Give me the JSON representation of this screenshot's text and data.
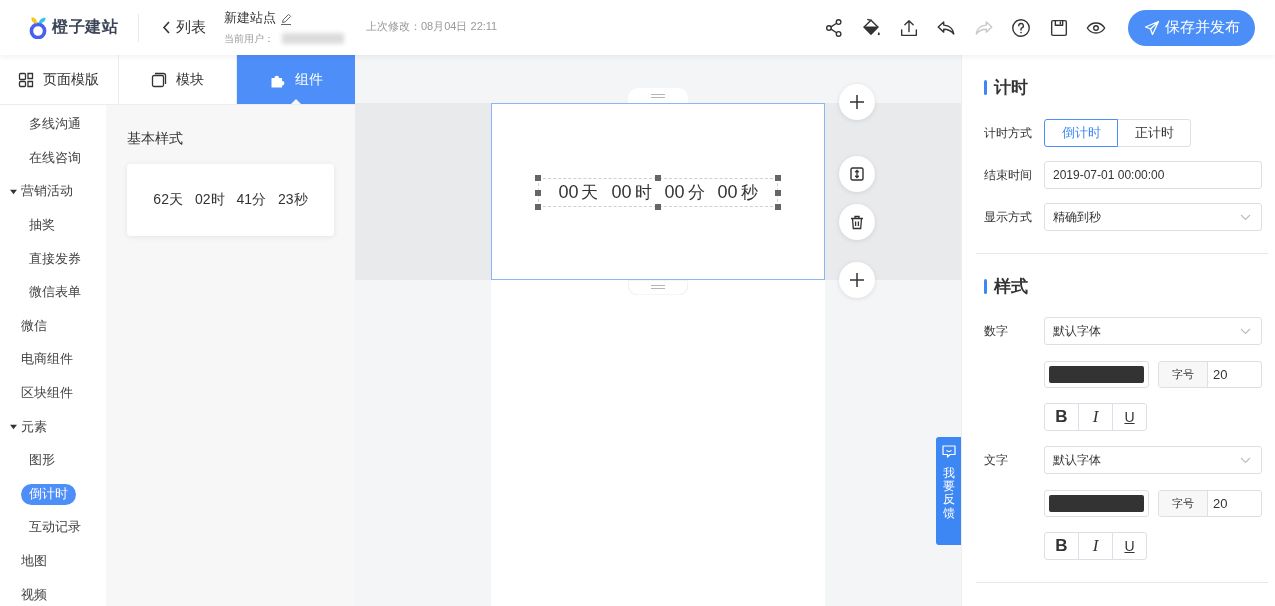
{
  "header": {
    "logo": {
      "text": "橙子建站"
    },
    "back": {
      "label": "列表"
    },
    "site": {
      "title": "新建站点",
      "user_label": "当前用户：",
      "user_blurred": true
    },
    "last_modified": "上次修改：08月04日 22:11",
    "tools": [
      {
        "kind": "share",
        "disabled": false
      },
      {
        "kind": "fill",
        "disabled": false
      },
      {
        "kind": "upload",
        "disabled": false
      },
      {
        "kind": "undo",
        "disabled": false
      },
      {
        "kind": "redo",
        "disabled": true
      },
      {
        "kind": "help",
        "disabled": false
      },
      {
        "kind": "save",
        "disabled": false
      },
      {
        "kind": "preview",
        "disabled": false
      }
    ],
    "publish": {
      "label": "保存并发布"
    }
  },
  "left_panel": {
    "tabs": [
      {
        "label": "页面模版",
        "kind": "template",
        "selected": false
      },
      {
        "label": "模块",
        "kind": "module",
        "selected": false
      },
      {
        "label": "组件",
        "kind": "component",
        "selected": true
      }
    ],
    "nav": {
      "continued": [
        {
          "label": "多线沟通",
          "selected": false
        },
        {
          "label": "在线咨询",
          "selected": false
        }
      ],
      "items": [
        {
          "label": "营销活动",
          "selected": false,
          "expanded": true,
          "children": [
            {
              "label": "抽奖",
              "selected": false
            },
            {
              "label": "直接发券",
              "selected": false
            },
            {
              "label": "微信表单",
              "selected": false
            }
          ]
        },
        {
          "label": "微信",
          "selected": false
        },
        {
          "label": "电商组件",
          "selected": false
        },
        {
          "label": "区块组件",
          "selected": false
        },
        {
          "label": "元素",
          "selected": false,
          "expanded": true,
          "children": [
            {
              "label": "图形",
              "selected": false
            },
            {
              "label": "倒计时",
              "selected": true
            },
            {
              "label": "互动记录",
              "selected": false
            }
          ]
        },
        {
          "label": "地图",
          "selected": false
        },
        {
          "label": "视频",
          "selected": false
        }
      ]
    },
    "group_title": "基本样式",
    "presets": [
      {
        "units": [
          {
            "value": "62",
            "unit": "天"
          },
          {
            "value": "02",
            "unit": "时"
          },
          {
            "value": "41",
            "unit": "分"
          },
          {
            "value": "23",
            "unit": "秒"
          }
        ]
      }
    ]
  },
  "canvas": {
    "section": {
      "selected": true,
      "countdown": {
        "selected": true,
        "units": [
          {
            "value": "00",
            "unit": "天"
          },
          {
            "value": "00",
            "unit": "时"
          },
          {
            "value": "00",
            "unit": "分"
          },
          {
            "value": "00",
            "unit": "秒"
          }
        ]
      }
    },
    "section_tools": [
      {
        "kind": "add"
      },
      {
        "kind": "height"
      },
      {
        "kind": "delete"
      },
      {
        "kind": "add"
      }
    ],
    "feedback": {
      "label": "我要反馈"
    }
  },
  "right_panel": {
    "timing": {
      "title": "计时",
      "mode": {
        "label": "计时方式",
        "options": [
          {
            "label": "倒计时",
            "selected": true
          },
          {
            "label": "正计时",
            "selected": false
          }
        ]
      },
      "end_time": {
        "label": "结束时间",
        "value": "2019-07-01 00:00:00"
      },
      "display": {
        "label": "显示方式",
        "value": "精确到秒"
      }
    },
    "style": {
      "title": "样式",
      "rows": [
        {
          "label": "数字",
          "font": "默认字体",
          "color": "#333333",
          "size_label": "字号",
          "size": "20",
          "format": [
            {
              "kind": "bold",
              "label": "B"
            },
            {
              "kind": "italic",
              "label": "I"
            },
            {
              "kind": "underline",
              "label": "U"
            }
          ]
        },
        {
          "label": "文字",
          "font": "默认字体",
          "color": "#333333",
          "size_label": "字号",
          "size": "20",
          "format": [
            {
              "kind": "bold",
              "label": "B"
            },
            {
              "kind": "italic",
              "label": "I"
            },
            {
              "kind": "underline",
              "label": "U"
            }
          ]
        }
      ]
    }
  }
}
